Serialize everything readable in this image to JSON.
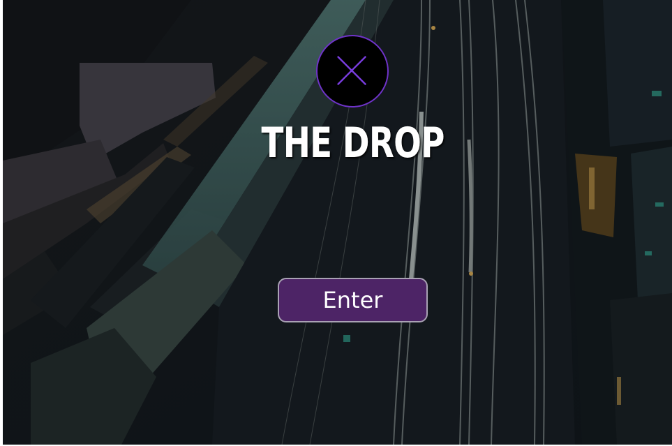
{
  "brand": {
    "title": "THE DROP",
    "logo_icon": "x-close-icon",
    "accent_color": "#6f33c9"
  },
  "actions": {
    "enter_label": "Enter",
    "button_color": "#4d2466"
  },
  "background": {
    "description_icon": "aerial-railway-night-photo"
  }
}
